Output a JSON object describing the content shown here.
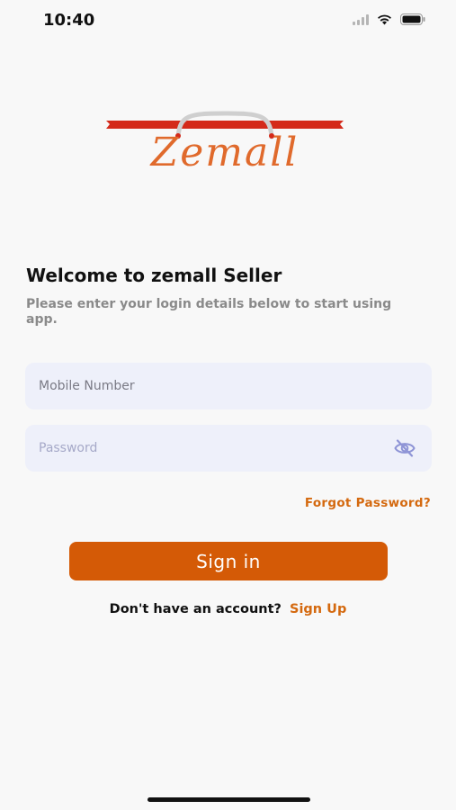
{
  "status_bar": {
    "time": "10:40",
    "icons": [
      "signal-icon",
      "wifi-icon",
      "battery-icon"
    ]
  },
  "logo": {
    "text": "Zemall",
    "colors": {
      "ribbon": "#d42a1a",
      "text": "#e06a2c",
      "handle": "#cfcfcf"
    }
  },
  "welcome": {
    "title": "Welcome to zemall Seller",
    "subtitle": "Please enter your login details below to start using app."
  },
  "form": {
    "mobile": {
      "placeholder": "Mobile Number",
      "value": ""
    },
    "password": {
      "placeholder": "Password",
      "value": "",
      "toggle_icon": "eye-off-icon"
    },
    "forgot_password_label": "Forgot Password?",
    "sign_in_label": "Sign in"
  },
  "signup": {
    "prompt": "Don't have an account?",
    "link_label": "Sign Up"
  },
  "colors": {
    "accent": "#d45a06",
    "link": "#d4690f",
    "field_background": "#eef0fa",
    "page_background": "#f8f8f8"
  }
}
